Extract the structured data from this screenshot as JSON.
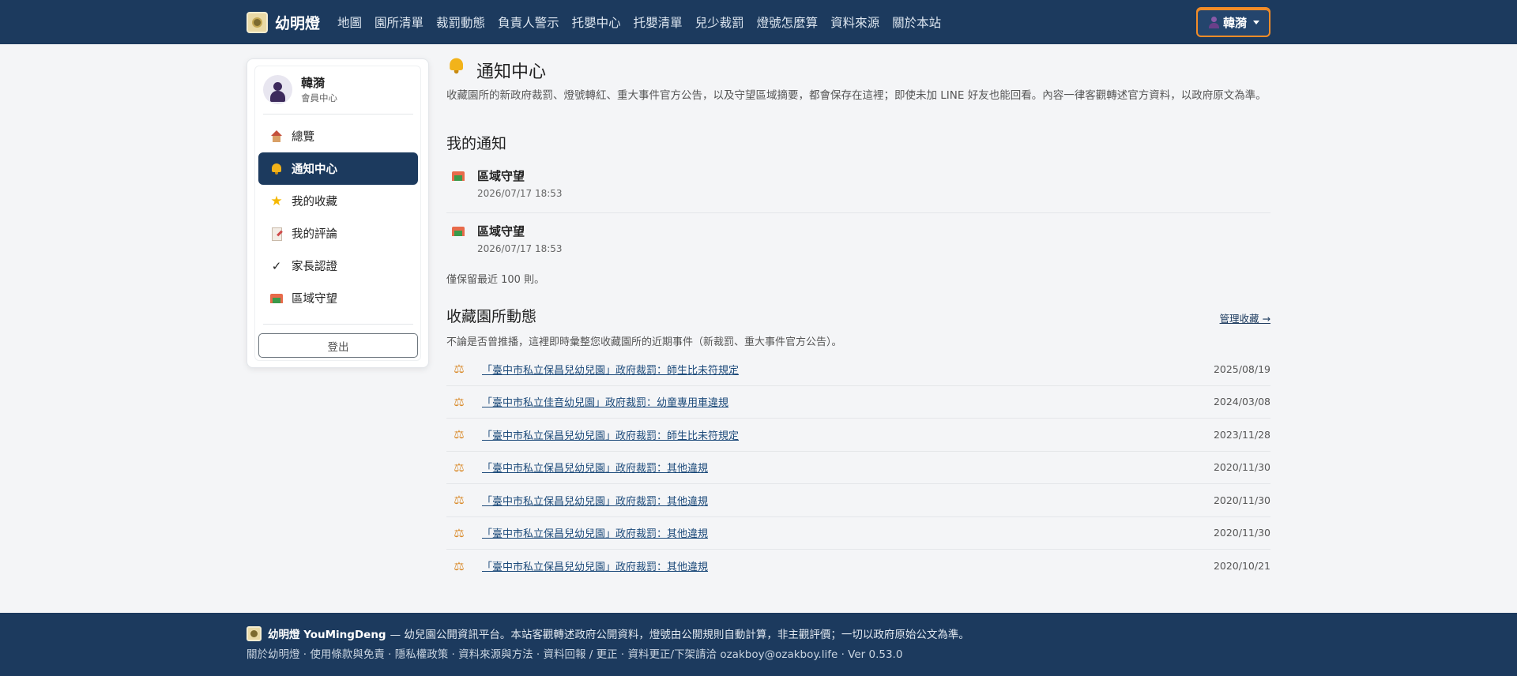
{
  "nav": {
    "brand": "幼明燈",
    "links": [
      "地圖",
      "園所清單",
      "裁罰動態",
      "負責人警示",
      "托嬰中心",
      "托嬰清單",
      "兒少裁罰",
      "燈號怎麼算",
      "資料來源",
      "關於本站"
    ],
    "user_name": "韓漪"
  },
  "sidebar": {
    "profile_name": "韓漪",
    "profile_sub": "會員中心",
    "items": [
      {
        "label": "總覽",
        "icon": "house-icon"
      },
      {
        "label": "通知中心",
        "icon": "bell-icon"
      },
      {
        "label": "我的收藏",
        "icon": "star-icon"
      },
      {
        "label": "我的評論",
        "icon": "memo-icon"
      },
      {
        "label": "家長認證",
        "icon": "check-icon"
      },
      {
        "label": "區域守望",
        "icon": "school-icon"
      }
    ],
    "logout": "登出"
  },
  "main": {
    "title": "通知中心",
    "intro": "收藏園所的新政府裁罰、燈號轉紅、重大事件官方公告，以及守望區域摘要，都會保存在這裡；即使未加 LINE 好友也能回看。內容一律客觀轉述官方資料，以政府原文為準。",
    "my_notifications": {
      "title": "我的通知",
      "items": [
        {
          "title": "區域守望",
          "time": "2026/07/17 18:53"
        },
        {
          "title": "區域守望",
          "time": "2026/07/17 18:53"
        }
      ],
      "note": "僅保留最近 100 則。"
    },
    "favorites": {
      "title": "收藏園所動態",
      "manage_link": "管理收藏 →",
      "intro": "不論是否曾推播，這裡即時彙整您收藏園所的近期事件（新裁罰、重大事件官方公告）。",
      "rows": [
        {
          "text": "「臺中市私立保昌兒幼兒園」政府裁罰：師生比未符規定",
          "date": "2025/08/19"
        },
        {
          "text": "「臺中市私立佳音幼兒園」政府裁罰：幼童專用車違規",
          "date": "2024/03/08"
        },
        {
          "text": "「臺中市私立保昌兒幼兒園」政府裁罰：師生比未符規定",
          "date": "2023/11/28"
        },
        {
          "text": "「臺中市私立保昌兒幼兒園」政府裁罰：其他違規",
          "date": "2020/11/30"
        },
        {
          "text": "「臺中市私立保昌兒幼兒園」政府裁罰：其他違規",
          "date": "2020/11/30"
        },
        {
          "text": "「臺中市私立保昌兒幼兒園」政府裁罰：其他違規",
          "date": "2020/11/30"
        },
        {
          "text": "「臺中市私立保昌兒幼兒園」政府裁罰：其他違規",
          "date": "2020/10/21"
        }
      ]
    }
  },
  "footer": {
    "brand": "幼明燈 YouMingDeng",
    "tagline": "— 幼兒園公開資訊平台。本站客觀轉述政府公開資料，燈號由公開規則自動計算，非主觀評價；一切以政府原始公文為準。",
    "links": "關於幼明燈 · 使用條款與免責 · 隱私權政策 · 資料來源與方法 · 資料回報 / 更正 · 資料更正/下架請洽 ozakboy@ozakboy.life · Ver 0.53.0"
  },
  "colors": {
    "navbar": "#1c3a5e",
    "accent": "#f28c28",
    "active_menu": "#1c3a5e",
    "background": "#f4f5f7"
  }
}
